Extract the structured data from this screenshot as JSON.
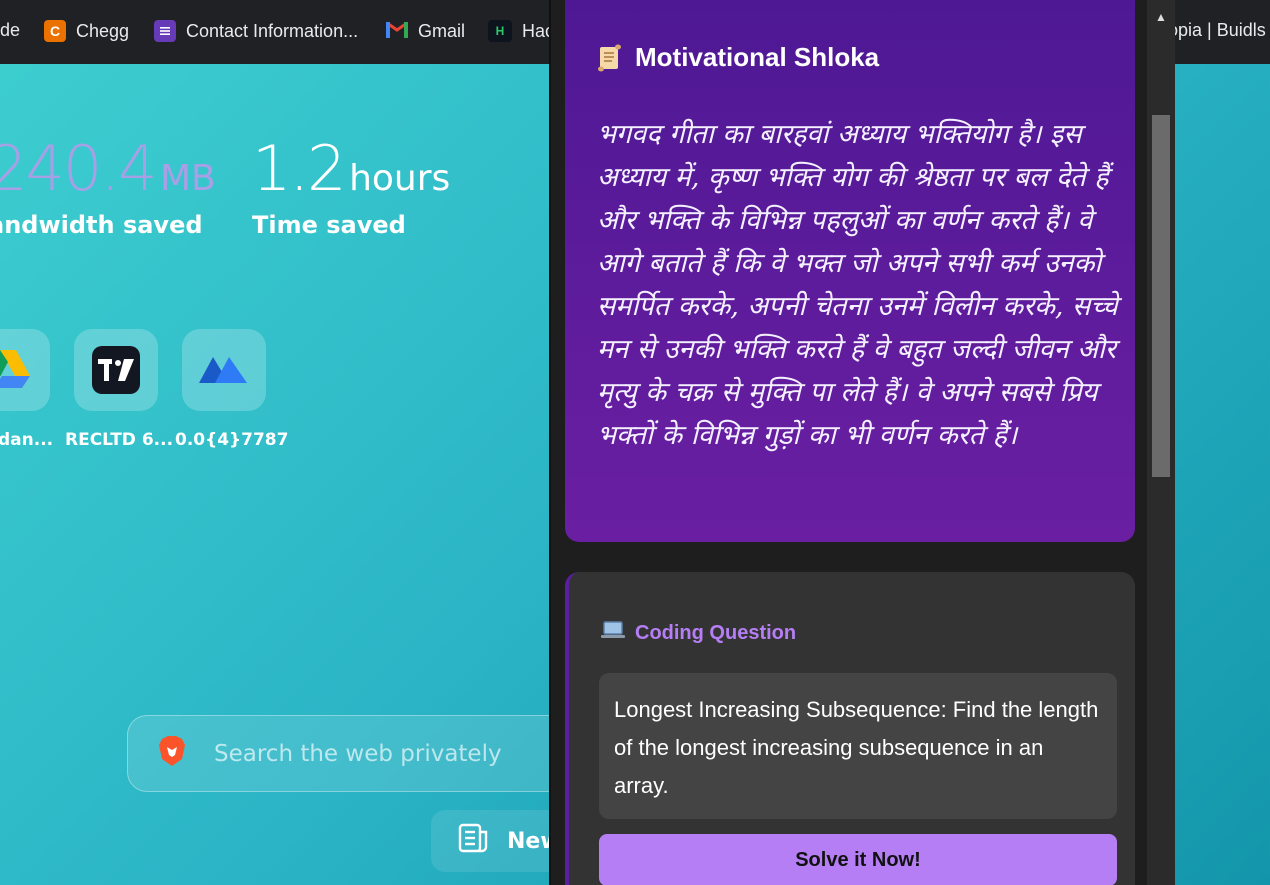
{
  "bookmarks": [
    {
      "label": "de",
      "icon": "bookmark-partial"
    },
    {
      "label": "Chegg",
      "icon": "chegg-icon",
      "color": "#eb7100"
    },
    {
      "label": "Contact Information...",
      "icon": "form-icon",
      "color": "#673ab7"
    },
    {
      "label": "Gmail",
      "icon": "gmail-icon"
    },
    {
      "label": "Hac",
      "icon": "hackerrank-icon"
    },
    {
      "label": "opia | Buidls",
      "icon": "bookmark-partial"
    }
  ],
  "stats": {
    "bandwidth": {
      "value": "240.4",
      "unit": "MB",
      "label": "andwidth saved"
    },
    "time": {
      "value": "1.2",
      "unit": "hours",
      "label": "Time saved"
    }
  },
  "tiles": [
    {
      "label": "dan...",
      "icon": "google-drive-icon"
    },
    {
      "label": "RECLTD 6...",
      "icon": "tradingview-icon"
    },
    {
      "label": "0.0{4}7787",
      "icon": "mexc-icon"
    }
  ],
  "search": {
    "placeholder": "Search the web privately"
  },
  "news_button": {
    "label": "New"
  },
  "popup": {
    "shloka": {
      "title": "Motivational Shloka",
      "text": "भगवद गीता का बारहवां अध्याय भक्तियोग है। इस अध्याय में, कृष्ण भक्ति योग की श्रेष्ठता पर बल देते हैं और भक्ति के विभिन्न पहलुओं का वर्णन करते हैं। वे आगे बताते हैं कि वे भक्त जो अपने सभी कर्म उनको समर्पित करके, अपनी चेतना उनमें विलीन करके, सच्चे मन से उनकी भक्ति करते हैं वे बहुत जल्दी जीवन और मृत्यु के चक्र से मुक्ति पा लेते हैं। वे अपने सबसे प्रिय भक्तों के विभिन्न गुड़ों का भी वर्णन करते हैं।"
    },
    "coding": {
      "title": "Coding Question",
      "question": "Longest Increasing Subsequence: Find the length of the longest increasing subsequence in an array.",
      "button": "Solve it Now!"
    }
  },
  "colors": {
    "accent": "#b57ef5",
    "shloka_bg": "#5a1a9c",
    "popup_bg": "#1e1e1e"
  }
}
